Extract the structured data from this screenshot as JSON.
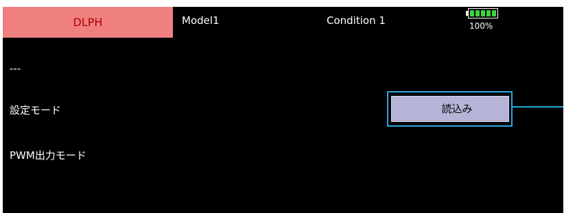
{
  "header": {
    "active_tab": "DLPH",
    "model": "Model1",
    "condition": "Condition 1",
    "battery": {
      "percent_label": "100%",
      "level": 1.0,
      "cells": 5,
      "color": "#3ed43e"
    }
  },
  "rows": {
    "placeholder": "---",
    "setting_mode_label": "設定モード",
    "pwm_mode_label": "PWM出力モード"
  },
  "button": {
    "read_label": "読込み"
  },
  "colors": {
    "active_tab_bg": "#f08080",
    "active_tab_text": "#b00000",
    "button_bg": "#b4b4d6",
    "focus_frame": "#29a8e0",
    "screen_bg": "#000000"
  }
}
